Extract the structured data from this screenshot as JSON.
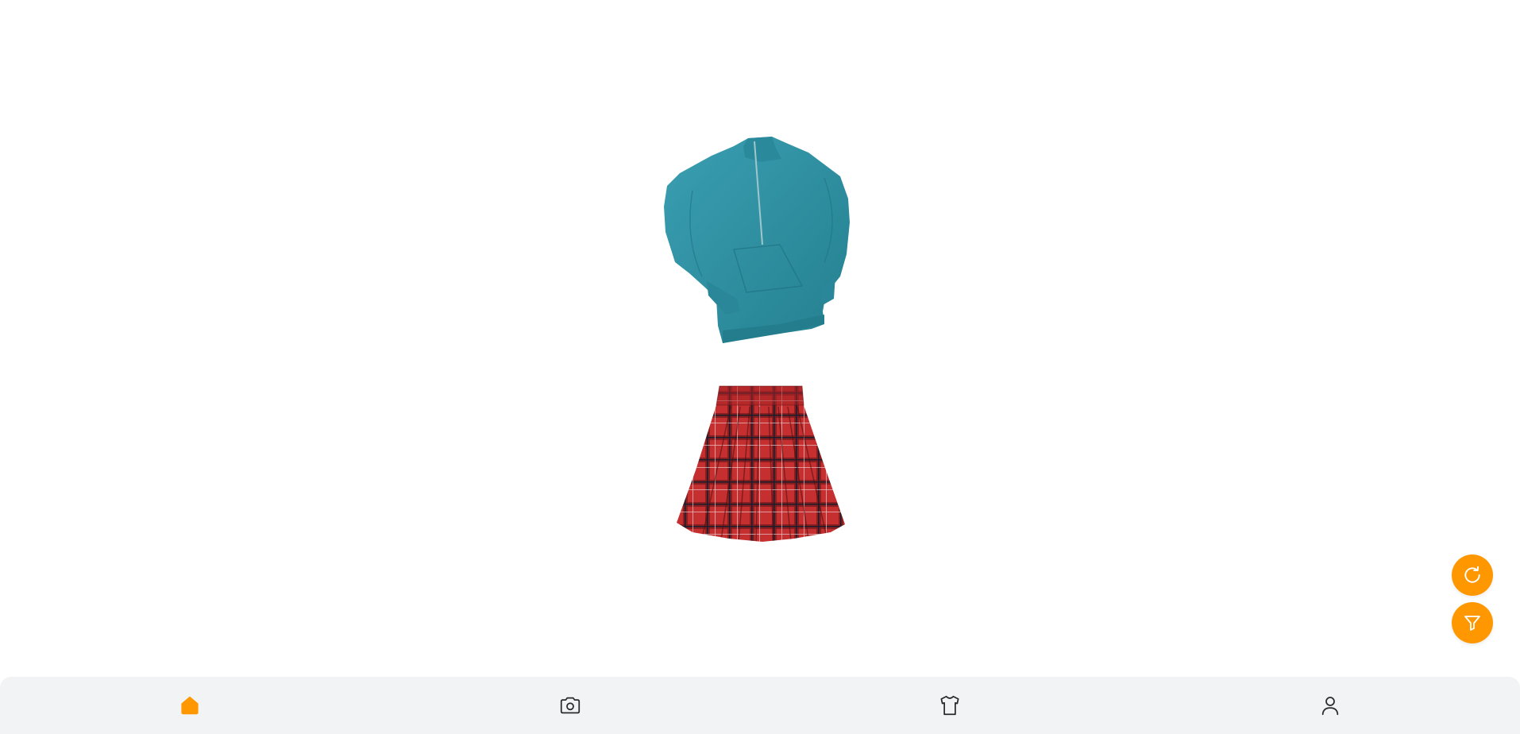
{
  "colors": {
    "accent": "#ff9800",
    "icon_inactive": "#2b2b2b",
    "nav_background": "#f2f3f5",
    "page_background": "#ffffff",
    "top_garment": "#2e93a6",
    "bottom_garment": "#c62f2f"
  },
  "outfit": {
    "top": {
      "icon": "teal-half-zip-sweatshirt-image"
    },
    "bottom": {
      "icon": "red-plaid-pleated-skirt-image"
    }
  },
  "fabs": [
    {
      "icon": "refresh-icon"
    },
    {
      "icon": "filter-icon"
    }
  ],
  "bottom_nav": {
    "active": "home",
    "items": [
      {
        "id": "home",
        "icon": "home-icon"
      },
      {
        "id": "camera",
        "icon": "camera-icon"
      },
      {
        "id": "wardrobe",
        "icon": "shirt-icon"
      },
      {
        "id": "profile",
        "icon": "user-icon"
      }
    ]
  }
}
